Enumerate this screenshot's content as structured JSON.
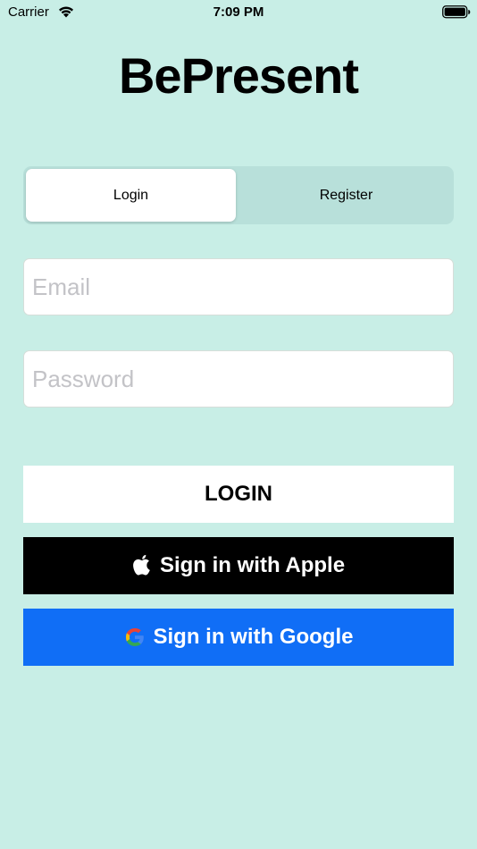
{
  "status_bar": {
    "carrier": "Carrier",
    "time": "7:09 PM"
  },
  "app": {
    "title": "BePresent"
  },
  "tabs": [
    {
      "label": "Login",
      "selected": true
    },
    {
      "label": "Register",
      "selected": false
    }
  ],
  "form": {
    "email": {
      "value": "",
      "placeholder": "Email"
    },
    "password": {
      "value": "",
      "placeholder": "Password"
    }
  },
  "buttons": {
    "login": "LOGIN",
    "apple": "Sign in with Apple",
    "google": "Sign in with Google"
  },
  "colors": {
    "background": "#c8eee6",
    "segment_track": "#b8e0da",
    "apple_button": "#000000",
    "google_button": "#106ef6"
  },
  "icons": {
    "wifi": "wifi-icon",
    "battery": "battery-icon",
    "apple": "apple-logo-icon",
    "google": "google-logo-icon"
  }
}
